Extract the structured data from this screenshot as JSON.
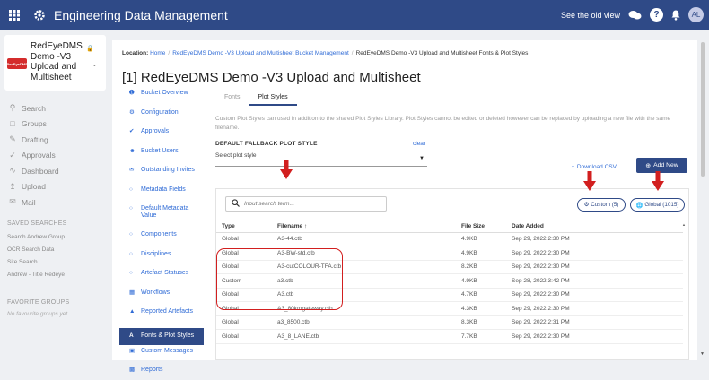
{
  "app": {
    "title": "Engineering Data Management",
    "old_view": "See the old view",
    "avatar_initials": "AL"
  },
  "project": {
    "name": "RedEyeDMS Demo -V3 Upload and Multisheet",
    "logo_text": "RedEyeDMS"
  },
  "nav": [
    {
      "label": "Search",
      "icon": "search-icon"
    },
    {
      "label": "Groups",
      "icon": "groups-icon"
    },
    {
      "label": "Drafting",
      "icon": "pencil-icon"
    },
    {
      "label": "Approvals",
      "icon": "check-icon"
    },
    {
      "label": "Dashboard",
      "icon": "chart-line-icon"
    },
    {
      "label": "Upload",
      "icon": "upload-icon"
    },
    {
      "label": "Mail",
      "icon": "mail-icon"
    }
  ],
  "saved_searches": {
    "heading": "SAVED SEARCHES",
    "items": [
      "Search Andrew Group",
      "OCR Search Data",
      "Site Search",
      "Andrew - Title Redeye"
    ]
  },
  "favorite_groups": {
    "heading": "FAVORITE GROUPS",
    "empty": "No favourite groups yet"
  },
  "breadcrumb": {
    "label": "Location:",
    "home": "Home",
    "bucket": "RedEyeDMS Demo -V3 Upload and Multisheet Bucket Management",
    "current": "RedEyeDMS Demo -V3 Upload and Multisheet Fonts & Plot Styles"
  },
  "page_title": "[1] RedEyeDMS Demo -V3 Upload and Multisheet",
  "subnav": [
    {
      "label": "Bucket Overview",
      "icon": "info-icon",
      "active": false
    },
    {
      "label": "Configuration",
      "icon": "gear-icon",
      "active": false
    },
    {
      "label": "Approvals",
      "icon": "check-circle-icon",
      "active": false
    },
    {
      "label": "Bucket Users",
      "icon": "user-icon",
      "active": false
    },
    {
      "label": "Outstanding Invites",
      "icon": "envelope-icon",
      "active": false
    },
    {
      "label": "Metadata Fields",
      "icon": "circle-icon",
      "active": false
    },
    {
      "label": "Default Metadata Value",
      "icon": "circle-icon",
      "active": false
    },
    {
      "label": "Components",
      "icon": "circle-icon",
      "active": false
    },
    {
      "label": "Disciplines",
      "icon": "circle-icon",
      "active": false
    },
    {
      "label": "Artefact Statuses",
      "icon": "circle-icon",
      "active": false
    },
    {
      "label": "Workflows",
      "icon": "workflow-icon",
      "active": false
    },
    {
      "label": "Reported Artefacts",
      "icon": "warning-icon",
      "active": false
    },
    {
      "label": "Fonts & Plot Styles",
      "icon": "font-icon",
      "active": true
    },
    {
      "label": "Custom Messages",
      "icon": "message-icon",
      "active": false
    },
    {
      "label": "Reports",
      "icon": "bar-chart-icon",
      "active": false
    }
  ],
  "tabs": [
    {
      "label": "Fonts",
      "active": false
    },
    {
      "label": "Plot Styles",
      "active": true
    }
  ],
  "description": "Custom Plot Styles can used in addition to the shared Plot Styles Library. Plot Styles cannot be edited or deleted however can be replaced by uploading a new file with the same filename.",
  "fallback": {
    "label": "DEFAULT FALLBACK PLOT STYLE",
    "clear": "clear",
    "select_value": "Select plot style"
  },
  "actions": {
    "download_csv": "Download CSV",
    "add_new": "Add New"
  },
  "table": {
    "search_placeholder": "Input search term...",
    "filter_custom": "Custom (5)",
    "filter_global": "Global (1015)",
    "headers": [
      "Type",
      "Filename ↑",
      "File Size",
      "Date Added"
    ],
    "rows": [
      [
        "Global",
        "A3-44.ctb",
        "4.9KB",
        "Sep 29, 2022 2:30 PM"
      ],
      [
        "Global",
        "A3-BW-std.ctb",
        "4.9KB",
        "Sep 29, 2022 2:30 PM"
      ],
      [
        "Global",
        "A3-cutCOLOUR-TFA.ctb",
        "8.2KB",
        "Sep 29, 2022 2:30 PM"
      ],
      [
        "Custom",
        "a3.ctb",
        "4.9KB",
        "Sep 28, 2022 3:42 PM"
      ],
      [
        "Global",
        "A3.ctb",
        "4.7KB",
        "Sep 29, 2022 2:30 PM"
      ],
      [
        "Global",
        "A3_80kmgateway.ctb",
        "4.3KB",
        "Sep 29, 2022 2:30 PM"
      ],
      [
        "Global",
        "a3_8500.ctb",
        "8.3KB",
        "Sep 29, 2022 2:31 PM"
      ],
      [
        "Global",
        "A3_8_LANE.ctb",
        "7.7KB",
        "Sep 29, 2022 2:30 PM"
      ]
    ]
  },
  "colors": {
    "topbar": "#2f4a87",
    "link": "#2f6bd6",
    "annotation": "#d21f1f"
  }
}
